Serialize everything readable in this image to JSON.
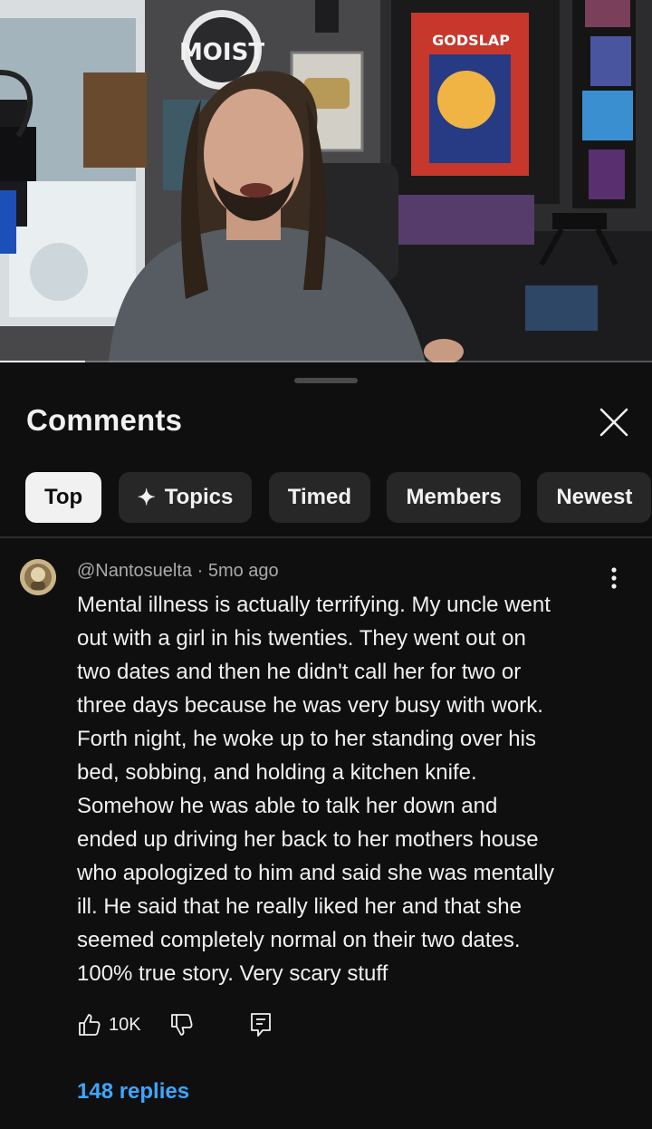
{
  "video": {
    "progress_fraction": 0.13,
    "scene_logo_text": "MOIST",
    "poster_text": "GODSLAP"
  },
  "sheet": {
    "title": "Comments",
    "chips": [
      {
        "label": "Top",
        "active": true
      },
      {
        "label": "Topics",
        "icon": "sparkle-icon",
        "active": false
      },
      {
        "label": "Timed",
        "active": false
      },
      {
        "label": "Members",
        "active": false
      },
      {
        "label": "Newest",
        "active": false
      }
    ]
  },
  "comment": {
    "author": "@Nantosuelta",
    "age": "5mo ago",
    "text": "Mental illness is actually terrifying. My uncle went\nout with a girl in his twenties. They went out on\ntwo dates and then he didn't call her for two or\nthree days because he was very busy with work.\nForth night, he woke up to her standing over his\nbed, sobbing, and holding a kitchen knife.\nSomehow he was able to talk her down and\nended up driving her back to her mothers house\nwho apologized to him and said she was mentally\nill. He said that he really liked her and that she\nseemed completely normal on their two dates.\n100% true story. Very scary stuff",
    "likes": "10K",
    "replies_label": "148 replies"
  },
  "colors": {
    "background": "#0f0f0f",
    "chip": "#272727",
    "chip_active": "#f1f1f1",
    "link": "#3ea6ff",
    "muted_text": "#aaaaaa"
  }
}
